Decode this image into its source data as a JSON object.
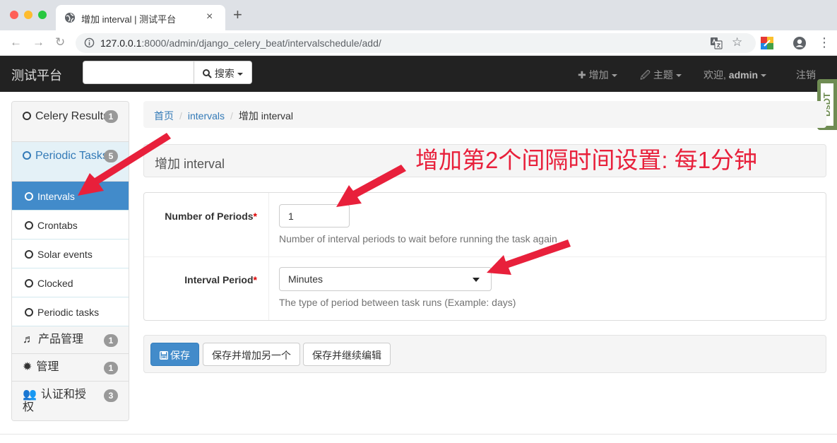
{
  "browser": {
    "tab_title": "增加 interval | 测试平台",
    "tab_close": "×",
    "new_tab": "+",
    "url_host": "127.0.0.1",
    "url_rest": ":8000/admin/django_celery_beat/intervalschedule/add/"
  },
  "navbar": {
    "brand": "测试平台",
    "search_label": "搜索",
    "add_label": "增加",
    "theme_label": "主题",
    "welcome": "欢迎,",
    "user": "admin",
    "logout": "注销"
  },
  "sidebar": {
    "items": [
      {
        "label": "Celery Results",
        "badge": "1"
      },
      {
        "label": "Periodic Tasks",
        "badge": "5"
      },
      {
        "label": "Intervals"
      },
      {
        "label": "Crontabs"
      },
      {
        "label": "Solar events"
      },
      {
        "label": "Clocked"
      },
      {
        "label": "Periodic tasks"
      },
      {
        "label": "产品管理",
        "badge": "1"
      },
      {
        "label": "管理",
        "badge": "1"
      },
      {
        "label": "认证和授权",
        "badge": "3"
      }
    ]
  },
  "breadcrumb": {
    "home": "首页",
    "section": "intervals",
    "current": "增加 interval"
  },
  "page": {
    "heading": "增加 interval",
    "annotation": "增加第2个间隔时间设置: 每1分钟"
  },
  "form": {
    "periods_label": "Number of Periods",
    "periods_value": "1",
    "periods_help": "Number of interval periods to wait before running the task again",
    "period_label": "Interval Period",
    "period_value": "Minutes",
    "period_help": "The type of period between task runs (Example: days)",
    "required_mark": "*"
  },
  "actions": {
    "save": "保存",
    "save_add": "保存并增加另一个",
    "save_continue": "保存并继续编辑"
  },
  "widget": {
    "text": "DsDT"
  },
  "colors": {
    "accent": "#428bca",
    "annotation": "#e8203b",
    "navbar": "#222222"
  }
}
